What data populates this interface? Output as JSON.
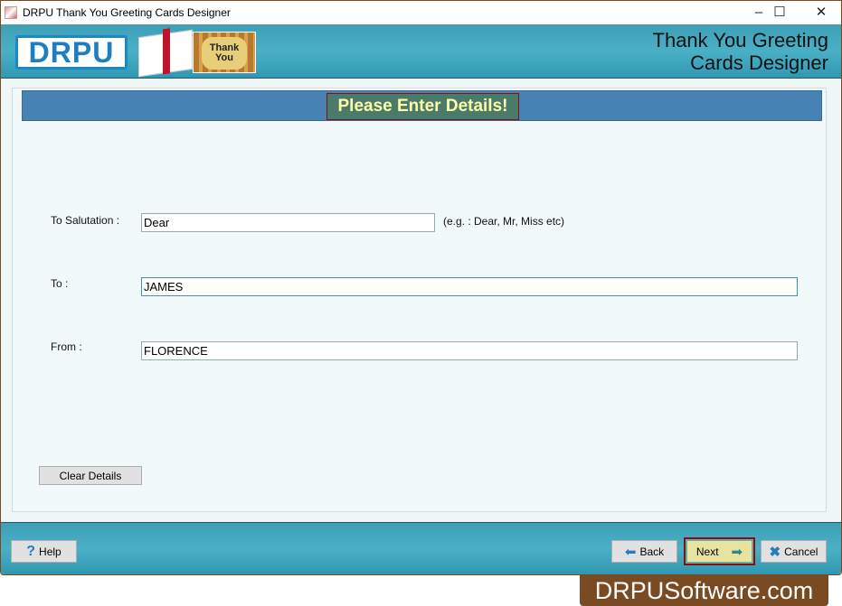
{
  "window": {
    "title": "DRPU Thank You Greeting Cards Designer",
    "minimize": "–",
    "maximize": "☐",
    "close": "✕"
  },
  "banner": {
    "logo": "DRPU",
    "card_text": "Thank You",
    "app_title_line1": "Thank You Greeting",
    "app_title_line2": "Cards Designer"
  },
  "form": {
    "heading": "Please Enter Details!",
    "salutation_label": "To Salutation :",
    "salutation_value": "Dear",
    "salutation_hint": "(e.g. : Dear, Mr, Miss etc)",
    "to_label": "To :",
    "to_value": "JAMES",
    "from_label": "From :",
    "from_value": "FLORENCE",
    "clear_label": "Clear Details"
  },
  "footer": {
    "help": "Help",
    "back": "Back",
    "next": "Next",
    "cancel": "Cancel"
  },
  "watermark": "DRPUSoftware.com"
}
